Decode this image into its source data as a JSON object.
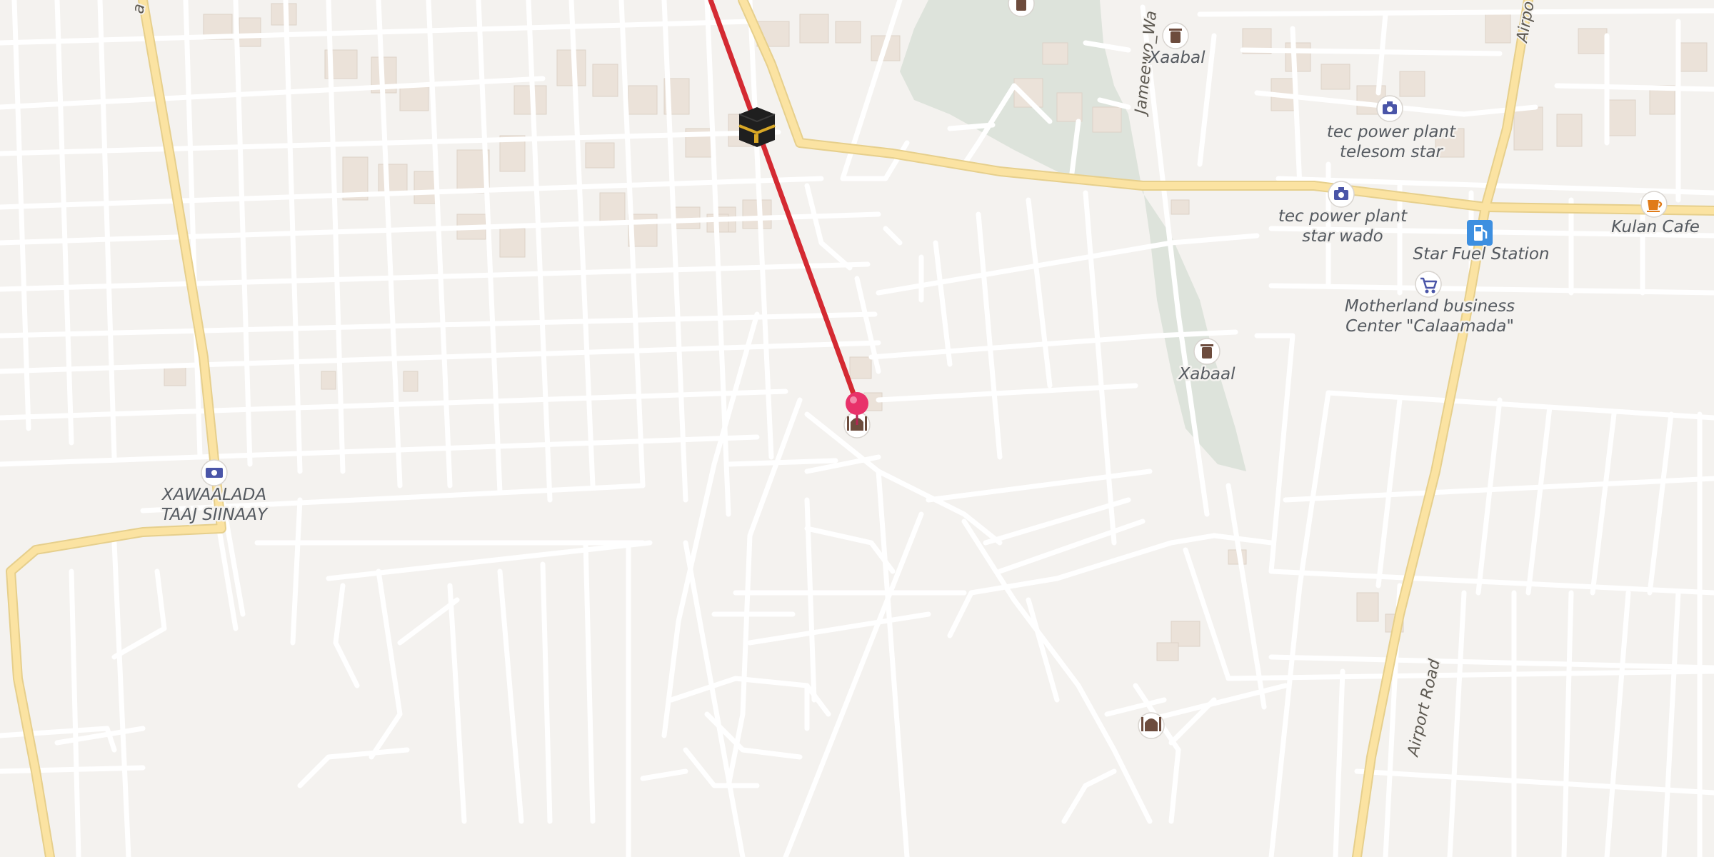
{
  "map": {
    "pois": [
      {
        "label": "Xaabal",
        "icon": "waste-bin-icon"
      },
      {
        "label": "tec power plant",
        "label2": "telesom star",
        "icon": "camera-icon"
      },
      {
        "label": "tec power plant",
        "label2": "star wado",
        "icon": "camera-icon"
      },
      {
        "label": "Kulan Cafe",
        "icon": "coffee-cup-icon"
      },
      {
        "label": "Star Fuel Station",
        "icon": "fuel-pump-icon"
      },
      {
        "label": "Motherland business",
        "label2": "Center \"Calaamada\"",
        "icon": "shopping-cart-icon"
      },
      {
        "label": "Xabaal",
        "icon": "waste-bin-icon"
      },
      {
        "label": "XAWAALADA",
        "label2": "TAAJ SIINAAY",
        "icon": "banknote-icon"
      }
    ],
    "roads": {
      "airport_road": "Airport Road",
      "airport_road_top": "Airpo",
      "jameewo": "Jameewo_Wa"
    },
    "markers": {
      "kaaba": "kaaba-icon",
      "pin": "location-pin-icon",
      "mosque": "mosque-icon"
    },
    "colors": {
      "background": "#f4f2ef",
      "minor_road": "#ffffff",
      "major_road": "#fbe3a2",
      "park": "#dde3db",
      "building": "#ebe2d9",
      "qibla_line": "#d42a32",
      "pin": "#e8326a",
      "poi_icon": "#4a55a8"
    }
  }
}
